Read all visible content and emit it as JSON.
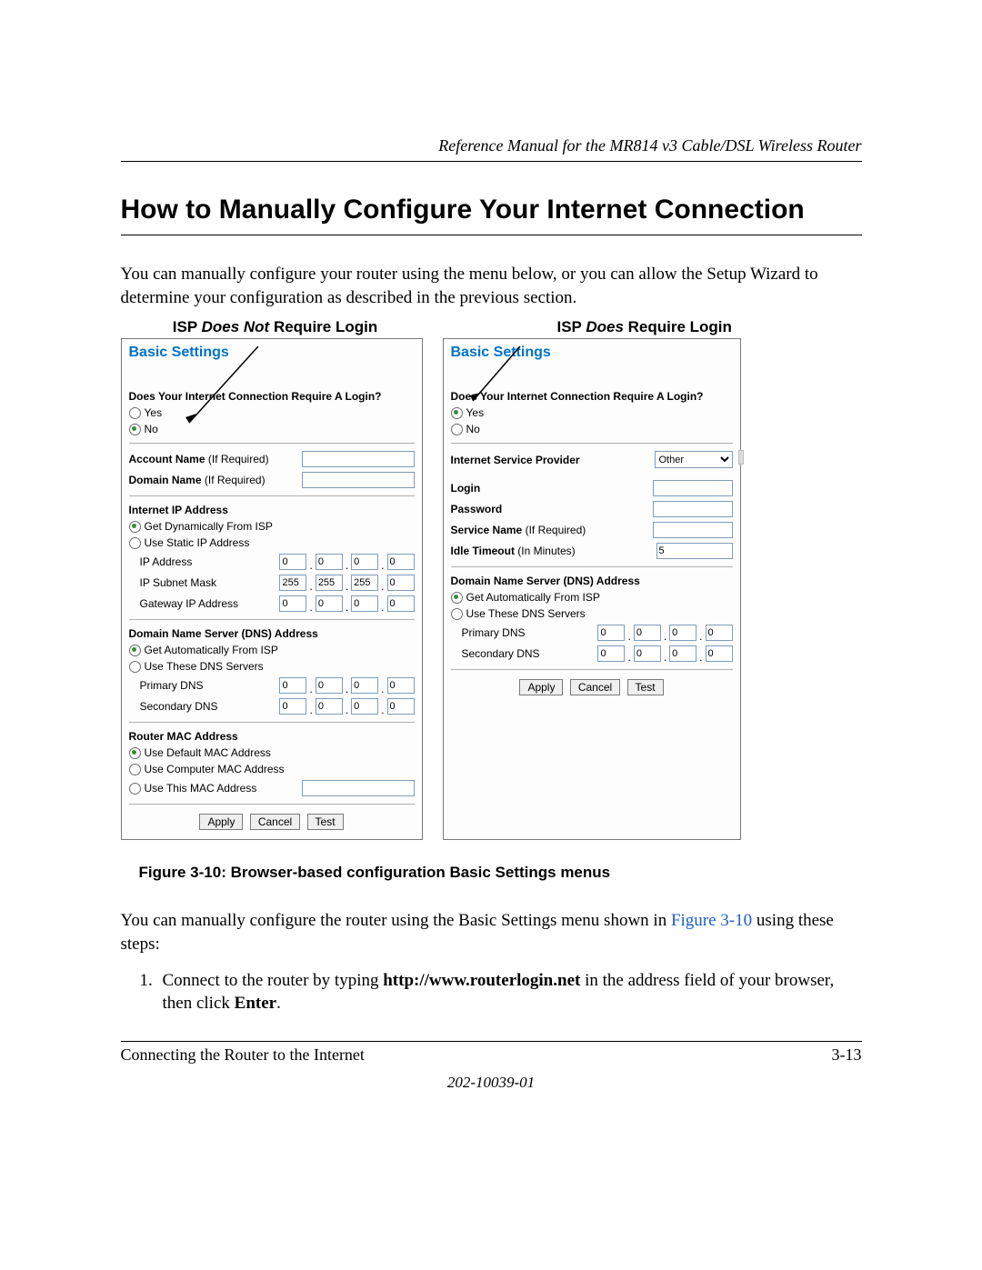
{
  "header": {
    "running": "Reference Manual for the MR814 v3 Cable/DSL Wireless Router"
  },
  "heading": "How to Manually Configure Your Internet Connection",
  "intro": "You can manually configure your router using the menu below, or you can allow the Setup Wizard to determine your configuration as described in the previous section.",
  "labels": {
    "left_prefix": "ISP ",
    "left_em": "Does Not",
    "left_suffix": " Require Login",
    "right_prefix": "ISP ",
    "right_em": "Does",
    "right_suffix": " Require Login"
  },
  "panel_common": {
    "title": "Basic Settings",
    "question": "Does Your Internet Connection Require A Login?",
    "yes": "Yes",
    "no": "No"
  },
  "panel_left": {
    "account_name": "Account Name",
    "if_required": "(If Required)",
    "domain_name": "Domain Name",
    "ip_head": "Internet IP Address",
    "get_dyn": "Get Dynamically From ISP",
    "use_static": "Use Static IP Address",
    "ip_addr": "IP Address",
    "subnet": "IP Subnet Mask",
    "gateway": "Gateway IP Address",
    "ip_octets": [
      "0",
      "0",
      "0",
      "0"
    ],
    "mask_octets": [
      "255",
      "255",
      "255",
      "0"
    ],
    "gw_octets": [
      "0",
      "0",
      "0",
      "0"
    ],
    "dns_head": "Domain Name Server (DNS) Address",
    "get_auto": "Get Automatically From ISP",
    "use_these": "Use These DNS Servers",
    "primary": "Primary DNS",
    "secondary": "Secondary DNS",
    "pdns": [
      "0",
      "0",
      "0",
      "0"
    ],
    "sdns": [
      "0",
      "0",
      "0",
      "0"
    ],
    "mac_head": "Router MAC Address",
    "use_default": "Use Default MAC Address",
    "use_computer": "Use Computer MAC Address",
    "use_this": "Use This MAC Address",
    "apply": "Apply",
    "cancel": "Cancel",
    "test": "Test"
  },
  "panel_right": {
    "isp_label": "Internet Service Provider",
    "isp_value": "Other",
    "login": "Login",
    "password": "Password",
    "service_name": "Service Name",
    "if_required": "(If Required)",
    "idle": "Idle Timeout",
    "idle_unit": "(In Minutes)",
    "idle_value": "5",
    "dns_head": "Domain Name Server (DNS) Address",
    "get_auto": "Get Automatically From ISP",
    "use_these": "Use These DNS Servers",
    "primary": "Primary DNS",
    "secondary": "Secondary DNS",
    "pdns": [
      "0",
      "0",
      "0",
      "0"
    ],
    "sdns": [
      "0",
      "0",
      "0",
      "0"
    ],
    "apply": "Apply",
    "cancel": "Cancel",
    "test": "Test"
  },
  "figure_caption": "Figure 3-10:  Browser-based configuration Basic Settings menus",
  "after_figure_pre": "You can manually configure the router using the Basic Settings menu shown in ",
  "after_figure_link": "Figure 3-10",
  "after_figure_post": " using these steps:",
  "step1_a": "Connect to the router by typing ",
  "step1_b": "http://www.routerlogin.net",
  "step1_c": " in the address field of your browser, then click ",
  "step1_d": "Enter",
  "step1_e": ".",
  "footer": {
    "section": "Connecting the Router to the Internet",
    "page": "3-13",
    "docnum": "202-10039-01"
  }
}
